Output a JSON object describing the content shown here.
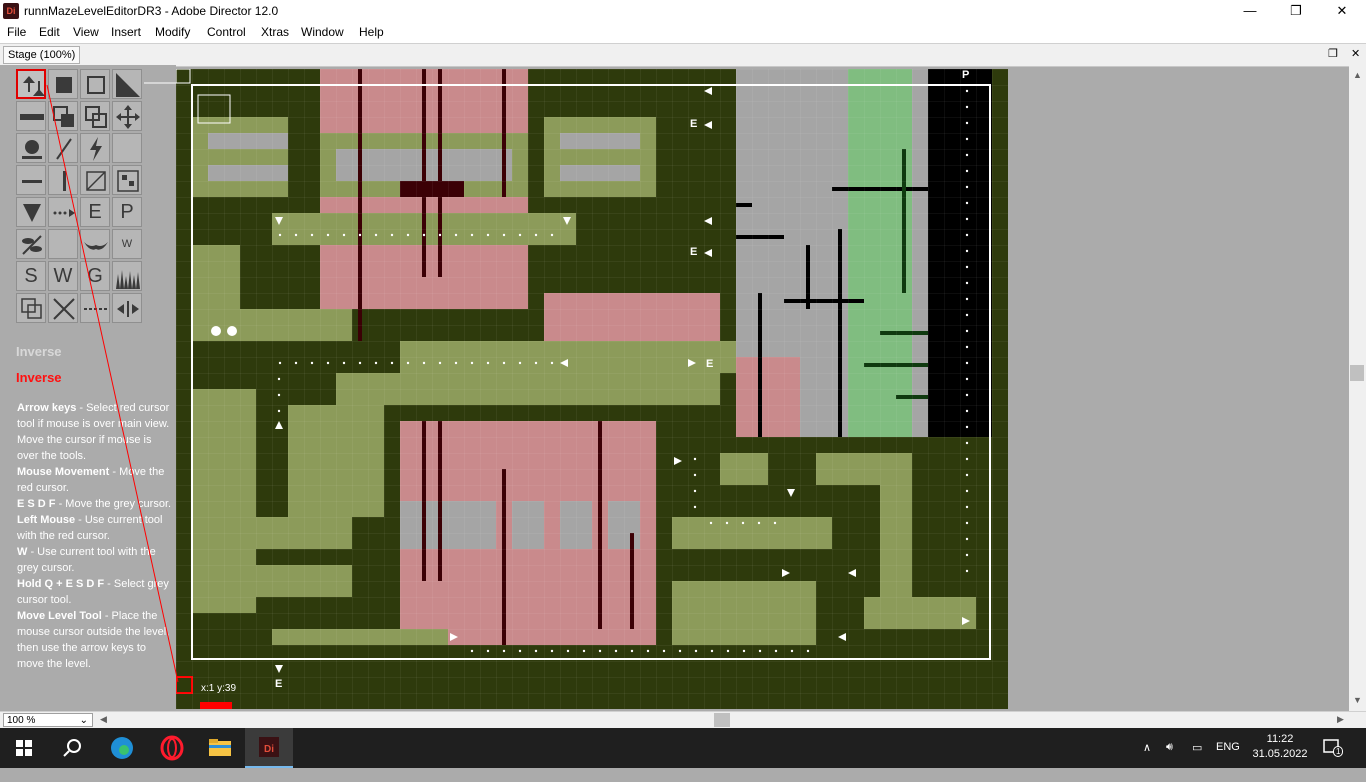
{
  "window": {
    "title": "runnMazeLevelEditorDR3 - Adobe Director 12.0",
    "app_icon": "Di",
    "minimize": "—",
    "maximize": "❐",
    "close": "✕"
  },
  "menu": [
    "File",
    "Edit",
    "View",
    "Insert",
    "Modify",
    "Control",
    "Xtras",
    "Window",
    "Help"
  ],
  "stage_tab": "Stage (100%)",
  "panel": {
    "inverse_a": "Inverse",
    "inverse_b": "Inverse",
    "help": [
      {
        "key": "Arrow keys",
        "text": " - Select red cursor tool if mouse is over main view. Move the cursor if mouse is over the tools."
      },
      {
        "key": "Mouse Movement",
        "text": " - Move the red cursor."
      },
      {
        "key": "E S D F",
        "text": " - Move the grey cursor."
      },
      {
        "key": "Left Mouse",
        "text": " - Use current tool with the red cursor."
      },
      {
        "key": "W",
        "text": " - Use current tool with the grey cursor."
      },
      {
        "key": "Hold Q + E S D F",
        "text": " - Select grey cursor tool."
      },
      {
        "key": "Move Level Tool",
        "text": " - Place the mouse cursor outside the level, then use the arrow keys to move the level."
      }
    ]
  },
  "tools": {
    "E": "E",
    "P": "P",
    "W": "W",
    "S": "S",
    "W2": "W",
    "G": "G"
  },
  "level": {
    "coord": "x:1 y:39",
    "marker_e": "E",
    "marker_p": "P"
  },
  "zoom": "100 %",
  "taskbar": {
    "lang": "ENG",
    "time": "11:22",
    "date": "31.05.2022",
    "notif": "1"
  }
}
